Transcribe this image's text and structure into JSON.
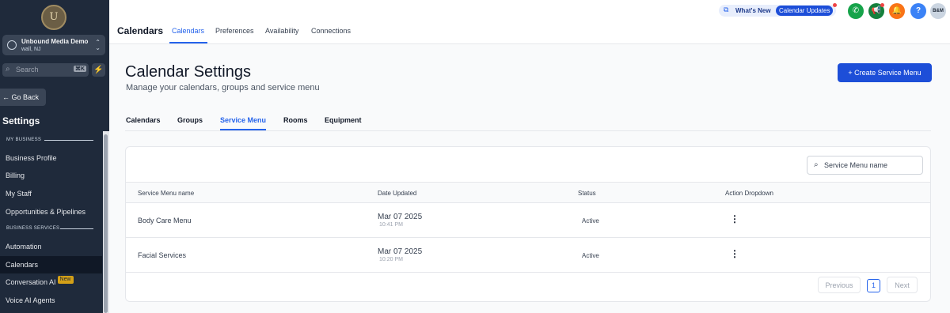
{
  "sidebar": {
    "logo_text": "U",
    "account": {
      "name": "Unbound Media Demo",
      "location": "wall, NJ"
    },
    "search": {
      "placeholder": "Search",
      "shortcut": "⌘K"
    },
    "go_back": "Go Back",
    "title": "Settings",
    "sections": [
      {
        "label": "MY BUSINESS"
      },
      {
        "label": "BUSINESS SERVICES"
      }
    ],
    "items": [
      {
        "label": "Business Profile"
      },
      {
        "label": "Billing"
      },
      {
        "label": "My Staff"
      },
      {
        "label": "Opportunities & Pipelines"
      },
      {
        "label": "Automation"
      },
      {
        "label": "Calendars",
        "active": true
      },
      {
        "label": "Conversation AI",
        "badge": "New"
      },
      {
        "label": "Voice AI Agents"
      }
    ]
  },
  "header": {
    "title": "Calendars",
    "tabs": [
      {
        "label": "Calendars",
        "active": true
      },
      {
        "label": "Preferences"
      },
      {
        "label": "Availability"
      },
      {
        "label": "Connections"
      }
    ],
    "whats_new": "What's New",
    "updates_pill": "Calendar Updates",
    "help": "?",
    "avatar_initials": "B&M"
  },
  "page": {
    "title": "Calendar Settings",
    "subtitle": "Manage your calendars, groups and service menu",
    "create_button": "+ Create Service Menu",
    "tabs": [
      {
        "label": "Calendars"
      },
      {
        "label": "Groups"
      },
      {
        "label": "Service Menu",
        "active": true
      },
      {
        "label": "Rooms"
      },
      {
        "label": "Equipment"
      }
    ]
  },
  "table": {
    "search_placeholder": "Service Menu name",
    "columns": [
      "Service Menu name",
      "Date Updated",
      "Status",
      "Action Dropdown"
    ],
    "rows": [
      {
        "name": "Body Care Menu",
        "date": "Mar 07 2025",
        "time": "10:41 PM",
        "status": "Active"
      },
      {
        "name": "Facial Services",
        "date": "Mar 07 2025",
        "time": "10:20 PM",
        "status": "Active"
      }
    ],
    "pagination": {
      "previous": "Previous",
      "page": "1",
      "next": "Next"
    }
  },
  "colors": {
    "sidebar_bg": "#1f2a3b",
    "accent": "#2563eb",
    "primary_button": "#1d4ed8",
    "phone": "#16a34a",
    "megaphone": "#15803d",
    "bell": "#f97316",
    "help": "#3b82f6",
    "badge_new": "#d4a017"
  }
}
